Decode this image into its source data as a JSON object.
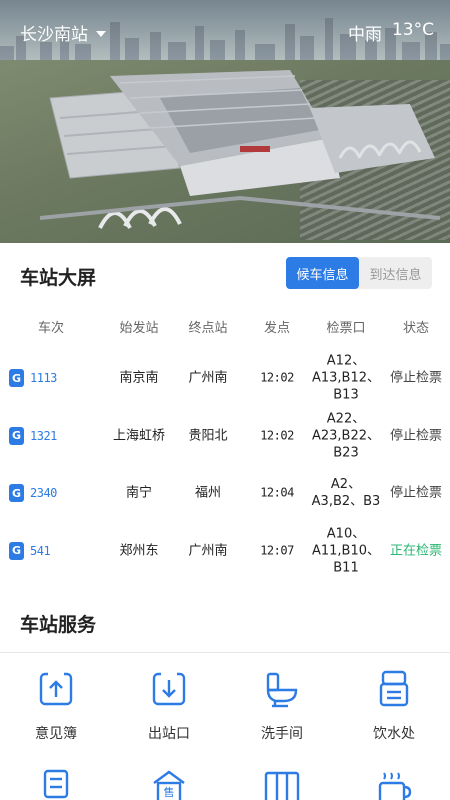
{
  "header": {
    "location": "长沙南站",
    "weather": "中雨",
    "temperature": "13°C"
  },
  "board": {
    "title": "车站大屏",
    "tabs": [
      {
        "label": "候车信息",
        "active": true
      },
      {
        "label": "到达信息",
        "active": false
      }
    ],
    "columns": [
      "车次",
      "始发站",
      "终点站",
      "发点",
      "检票口",
      "状态"
    ],
    "rows": [
      {
        "badge": "G",
        "train": "1113",
        "origin": "南京南",
        "dest": "广州南",
        "depart": "12:02",
        "gates": [
          "A12、",
          "A13,B12、",
          "B13"
        ],
        "status": "停止检票",
        "status_color": "#444444"
      },
      {
        "badge": "G",
        "train": "1321",
        "origin": "上海虹桥",
        "dest": "贵阳北",
        "depart": "12:02",
        "gates": [
          "A22、",
          "A23,B22、",
          "B23"
        ],
        "status": "停止检票",
        "status_color": "#444444"
      },
      {
        "badge": "G",
        "train": "2340",
        "origin": "南宁",
        "dest": "福州",
        "depart": "12:04",
        "gates": [
          "A2、",
          "A3,B2、B3"
        ],
        "status": "停止检票",
        "status_color": "#444444"
      },
      {
        "badge": "G",
        "train": "541",
        "origin": "郑州东",
        "dest": "广州南",
        "depart": "12:07",
        "gates": [
          "A10、",
          "A11,B10、",
          "B11"
        ],
        "status": "正在检票",
        "status_color": "#2bb673"
      }
    ]
  },
  "services": {
    "title": "车站服务",
    "items": [
      {
        "label": "意见簿",
        "icon": "feedback-upload-icon"
      },
      {
        "label": "出站口",
        "icon": "exit-download-icon"
      },
      {
        "label": "洗手间",
        "icon": "toilet-icon"
      },
      {
        "label": "饮水处",
        "icon": "water-dispenser-icon"
      },
      {
        "label": "",
        "icon": "monitor-icon"
      },
      {
        "label": "",
        "icon": "ticket-office-icon"
      },
      {
        "label": "",
        "icon": "storage-lockers-icon"
      },
      {
        "label": "",
        "icon": "hot-drink-icon"
      }
    ]
  },
  "colors": {
    "accent": "#2d7be5",
    "checking": "#2bb673"
  }
}
